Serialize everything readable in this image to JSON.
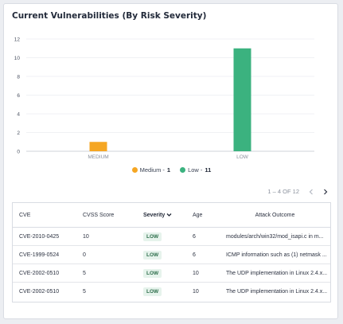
{
  "widget": {
    "title": "Current Vulnerabilities (By Risk Severity)"
  },
  "chart_data": {
    "type": "bar",
    "categories": [
      "MEDIUM",
      "LOW"
    ],
    "values": [
      1,
      11
    ],
    "colors": [
      "#f5a623",
      "#3bb27f"
    ],
    "ylim": [
      0,
      12
    ],
    "yticks": [
      "0",
      "2",
      "4",
      "6",
      "8",
      "10",
      "12"
    ],
    "grid": true
  },
  "legend": [
    {
      "label": "Medium - ",
      "count": "1",
      "color": "#f5a623"
    },
    {
      "label": "Low - ",
      "count": "11",
      "color": "#3bb27f"
    }
  ],
  "pagination": {
    "text": "1 – 4 OF 12"
  },
  "table": {
    "headers": {
      "cve": "CVE",
      "cvss": "CVSS Score",
      "severity": "Severity",
      "age": "Age",
      "outcome": "Attack Outcome"
    },
    "rows": [
      {
        "cve": "CVE-2010-0425",
        "cvss": "10",
        "severity": "LOW",
        "age": "6",
        "outcome": "modules/arch/win32/mod_isapi.c in m..."
      },
      {
        "cve": "CVE-1999-0524",
        "cvss": "0",
        "severity": "LOW",
        "age": "6",
        "outcome": "ICMP information such as (1) netmask ..."
      },
      {
        "cve": "CVE-2002-0510",
        "cvss": "5",
        "severity": "LOW",
        "age": "10",
        "outcome": "The UDP implementation in Linux 2.4.x..."
      },
      {
        "cve": "CVE-2002-0510",
        "cvss": "5",
        "severity": "LOW",
        "age": "10",
        "outcome": "The UDP implementation in Linux 2.4.x..."
      }
    ]
  },
  "icons": {
    "sort": "chevron-down-icon",
    "prev": "chevron-left-icon",
    "next": "chevron-right-icon"
  }
}
